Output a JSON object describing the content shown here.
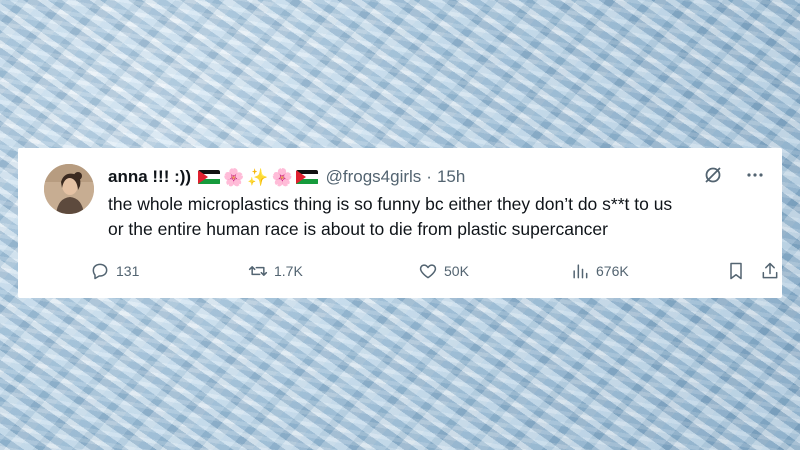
{
  "post": {
    "display_name": "anna !!! :))",
    "handle": "@frogs4girls",
    "separator": "·",
    "time": "15h",
    "name_emojis": [
      "palestine-flag",
      "cherry-blossom",
      "sparkles",
      "cherry-blossom",
      "palestine-flag"
    ],
    "text_lines": [
      "the whole microplastics thing is so funny bc either they don’t do s**t to us",
      "or the entire human race is about to die from plastic supercancer"
    ],
    "top_icons": [
      "grok-icon",
      "more-icon"
    ]
  },
  "metrics": {
    "replies": "131",
    "reposts": "1.7K",
    "likes": "50K",
    "views": "676K"
  },
  "colors": {
    "text": "#0f1419",
    "secondary": "#536471",
    "card": "#ffffff",
    "background": "#9fbfd6"
  },
  "emoji_chars": {
    "cherry_blossom": "🌸",
    "sparkles": "✨"
  }
}
